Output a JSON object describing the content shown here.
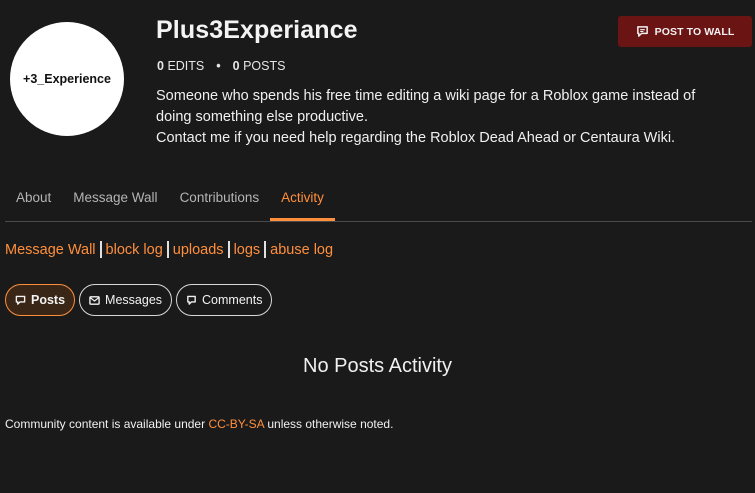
{
  "profile": {
    "avatar_text": "+3_Experience",
    "username": "Plus3Experiance",
    "edits_count": "0",
    "edits_label": "EDITS",
    "posts_count": "0",
    "posts_label": "POSTS",
    "bio_lines": [
      "Someone who spends his free time editing a wiki page for a Roblox game instead of",
      "doing something else productive.",
      "Contact me if you need help regarding the Roblox Dead Ahead or Centaura Wiki."
    ]
  },
  "header": {
    "post_to_wall_label": "POST TO WALL"
  },
  "tabs": [
    {
      "label": "About",
      "active": false
    },
    {
      "label": "Message Wall",
      "active": false
    },
    {
      "label": "Contributions",
      "active": false
    },
    {
      "label": "Activity",
      "active": true
    }
  ],
  "links": [
    "Message Wall",
    "block log",
    "uploads",
    "logs",
    "abuse log"
  ],
  "filters": [
    {
      "label": "Posts",
      "icon": "speech-bubble-icon",
      "active": true
    },
    {
      "label": "Messages",
      "icon": "envelope-icon",
      "active": false
    },
    {
      "label": "Comments",
      "icon": "comment-icon",
      "active": false
    }
  ],
  "main": {
    "empty_message": "No Posts Activity"
  },
  "footer": {
    "text_before": "Community content is available under ",
    "license_link": "CC-BY-SA",
    "text_after": " unless otherwise noted."
  },
  "colors": {
    "accent": "#ff8f3d",
    "button_bg": "#6b1414",
    "page_bg": "#1b1a1a"
  }
}
